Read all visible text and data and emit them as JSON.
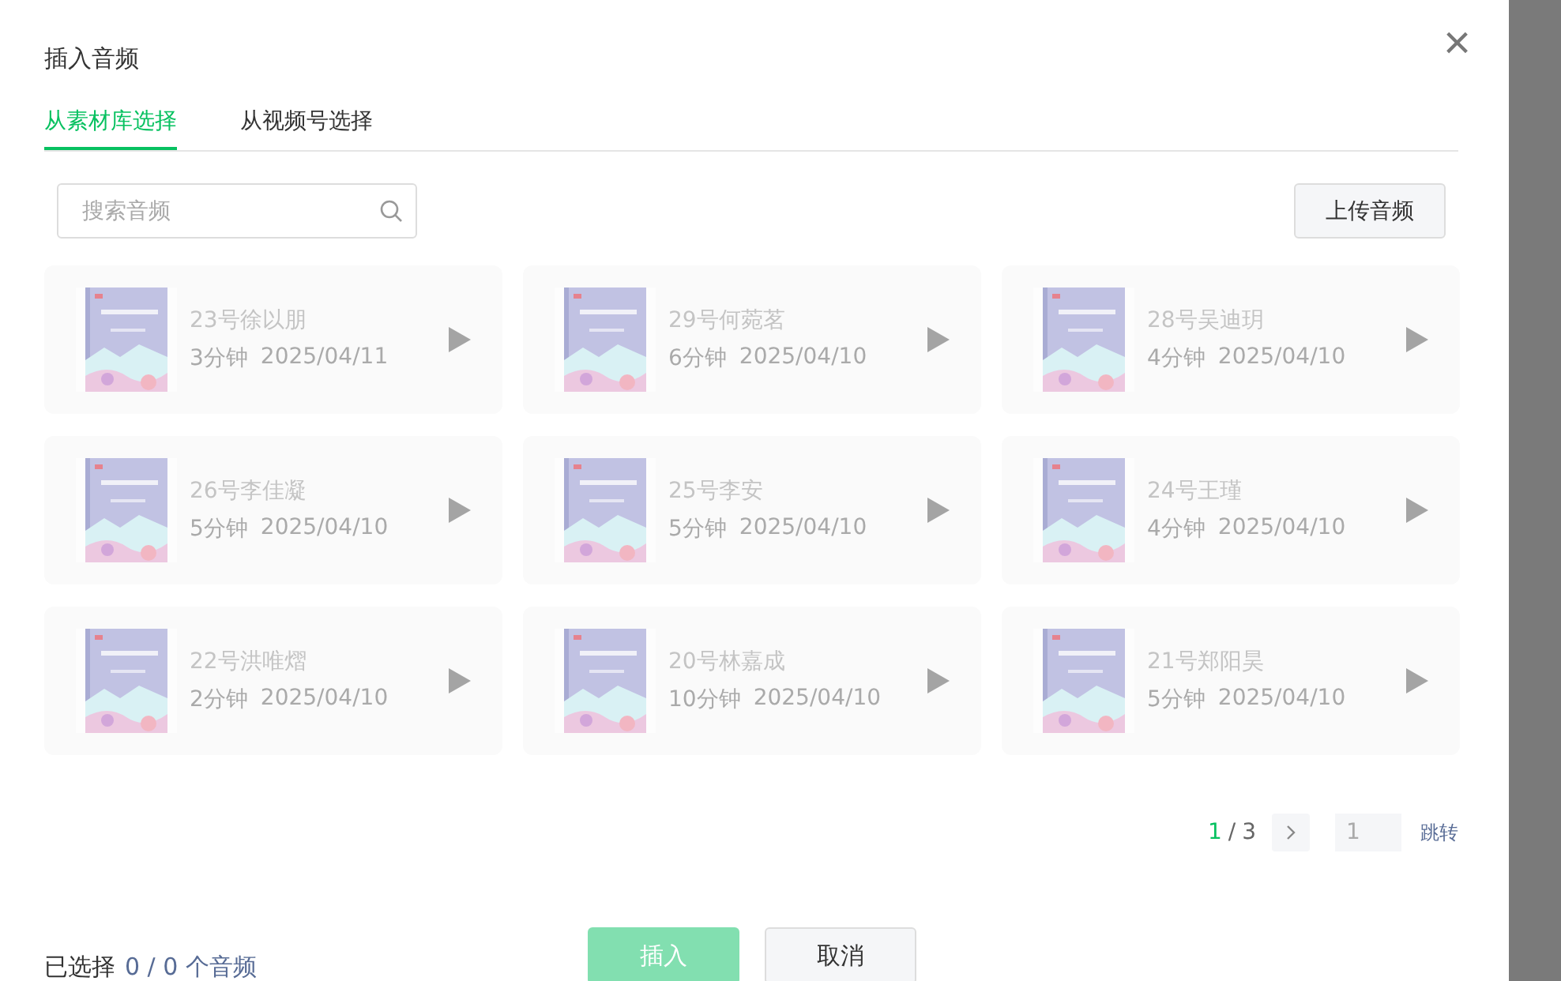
{
  "dialog": {
    "title": "插入音频",
    "close": "×"
  },
  "tabs": [
    {
      "label": "从素材库选择",
      "selected": true
    },
    {
      "label": "从视频号选择",
      "selected": false
    }
  ],
  "search": {
    "placeholder": "搜索音频"
  },
  "upload_button": "上传音频",
  "audios": [
    {
      "title": "23号徐以朋",
      "duration": "3分钟",
      "date": "2025/04/11",
      "disabled": true
    },
    {
      "title": "29号何菀茗",
      "duration": "6分钟",
      "date": "2025/04/10",
      "disabled": true
    },
    {
      "title": "28号吴迪玥",
      "duration": "4分钟",
      "date": "2025/04/10",
      "disabled": true
    },
    {
      "title": "26号李佳凝",
      "duration": "5分钟",
      "date": "2025/04/10",
      "disabled": true
    },
    {
      "title": "25号李安",
      "duration": "5分钟",
      "date": "2025/04/10",
      "disabled": true
    },
    {
      "title": "24号王瑾",
      "duration": "4分钟",
      "date": "2025/04/10",
      "disabled": true
    },
    {
      "title": "22号洪唯熠",
      "duration": "2分钟",
      "date": "2025/04/10",
      "disabled": true
    },
    {
      "title": "20号林嘉成",
      "duration": "10分钟",
      "date": "2025/04/10",
      "disabled": true
    },
    {
      "title": "21号郑阳昊",
      "duration": "5分钟",
      "date": "2025/04/10",
      "disabled": true
    }
  ],
  "pagination": {
    "current": "1",
    "separator": "/",
    "total": "3",
    "jump_value": "1",
    "jump": "跳转"
  },
  "footer": {
    "selected_label": "已选择",
    "selected_count": "0 / 0 个音频",
    "insert": "插入",
    "insert_disabled": true,
    "cancel": "取消"
  }
}
